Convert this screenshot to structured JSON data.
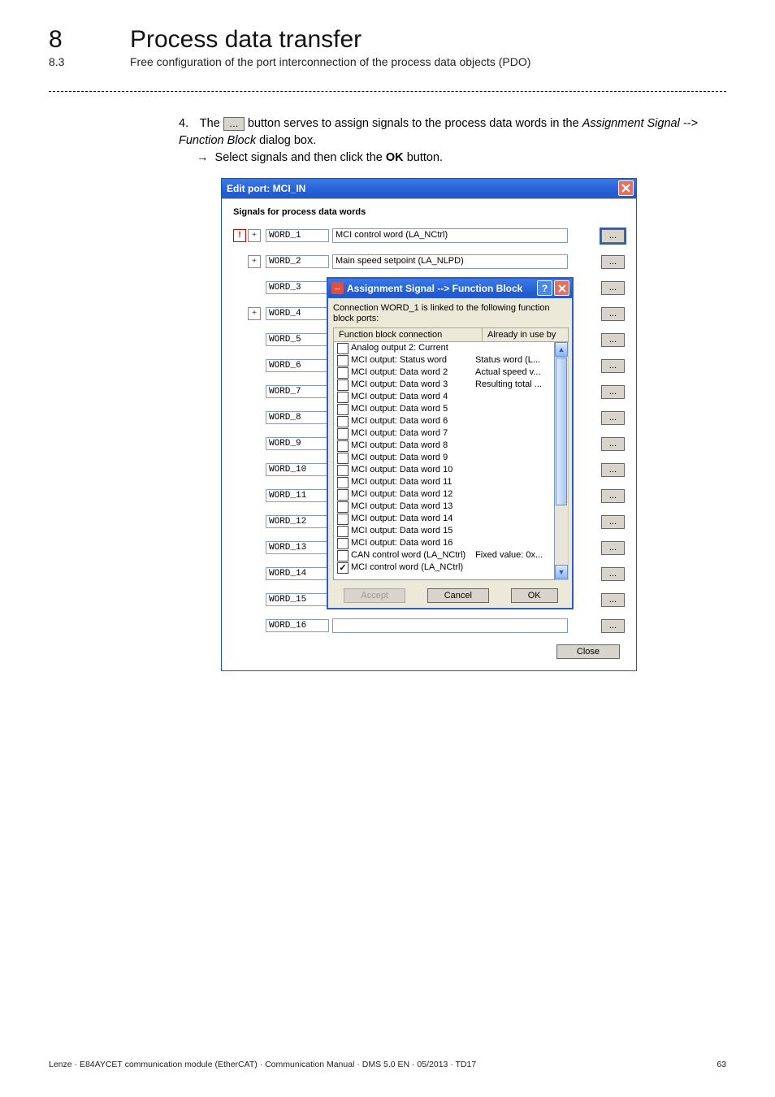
{
  "doc": {
    "chapter_num": "8",
    "chapter_title": "Process data transfer",
    "section_num": "8.3",
    "section_title": "Free configuration of the port interconnection of the process data objects (PDO)",
    "step_num": "4.",
    "step_text_a": "The",
    "inline_button": "…",
    "step_text_b": "button serves to assign signals to the process data words in the",
    "step_italic1": "Assignment Signal --> Function Block",
    "step_text_c": "dialog box.",
    "arrow": "→",
    "step_text_d": "Select signals and then click the",
    "ok_bold": "OK",
    "step_text_e": "button.",
    "footer_left": "Lenze · E84AYCET communication module (EtherCAT) · Communication Manual · DMS 5.0 EN · 05/2013 · TD17",
    "footer_page": "63"
  },
  "win": {
    "title": "Edit port: MCI_IN",
    "panel_heading": "Signals for process data words",
    "dots": "...",
    "close": "Close",
    "rows": [
      {
        "name": "WORD_1",
        "value": "MCI control word (LA_NCtrl)",
        "flag_excl": true,
        "flag_plus": true,
        "blue_dots": true
      },
      {
        "name": "WORD_2",
        "value": "Main speed setpoint (LA_NLPD)",
        "flag_plus": true
      },
      {
        "name": "WORD_3",
        "value": ""
      },
      {
        "name": "WORD_4",
        "value": "",
        "flag_plus": true,
        "flag_plus_leading": true
      },
      {
        "name": "WORD_5",
        "value": ""
      },
      {
        "name": "WORD_6",
        "value": ""
      },
      {
        "name": "WORD_7",
        "value": ""
      },
      {
        "name": "WORD_8",
        "value": ""
      },
      {
        "name": "WORD_9",
        "value": ""
      },
      {
        "name": "WORD_10",
        "value": ""
      },
      {
        "name": "WORD_11",
        "value": ""
      },
      {
        "name": "WORD_12",
        "value": ""
      },
      {
        "name": "WORD_13",
        "value": ""
      },
      {
        "name": "WORD_14",
        "value": ""
      },
      {
        "name": "WORD_15",
        "value": ""
      },
      {
        "name": "WORD_16",
        "value": ""
      }
    ]
  },
  "popup": {
    "title": "Assignment Signal --> Function Block",
    "msg": "Connection WORD_1 is linked to the following function block ports:",
    "col1": "Function block connection",
    "col2": "Already in use by",
    "accept": "Accept",
    "cancel": "Cancel",
    "ok": "OK",
    "items": [
      {
        "label": "Analog output 2: Current",
        "use": ""
      },
      {
        "label": "MCI output: Status word",
        "use": "Status word (L..."
      },
      {
        "label": "MCI output: Data word 2",
        "use": "Actual speed v..."
      },
      {
        "label": "MCI output: Data word 3",
        "use": "Resulting total ..."
      },
      {
        "label": "MCI output: Data word 4",
        "use": ""
      },
      {
        "label": "MCI output: Data word 5",
        "use": ""
      },
      {
        "label": "MCI output: Data word 6",
        "use": ""
      },
      {
        "label": "MCI output: Data word 7",
        "use": ""
      },
      {
        "label": "MCI output: Data word 8",
        "use": ""
      },
      {
        "label": "MCI output: Data word 9",
        "use": ""
      },
      {
        "label": "MCI output: Data word 10",
        "use": ""
      },
      {
        "label": "MCI output: Data word 11",
        "use": ""
      },
      {
        "label": "MCI output: Data word 12",
        "use": ""
      },
      {
        "label": "MCI output: Data word 13",
        "use": ""
      },
      {
        "label": "MCI output: Data word 14",
        "use": ""
      },
      {
        "label": "MCI output: Data word 15",
        "use": ""
      },
      {
        "label": "MCI output: Data word 16",
        "use": ""
      },
      {
        "label": "CAN control word (LA_NCtrl)",
        "use": "Fixed value: 0x..."
      },
      {
        "label": "MCI control word (LA_NCtrl)",
        "use": "",
        "checked": true
      }
    ]
  }
}
